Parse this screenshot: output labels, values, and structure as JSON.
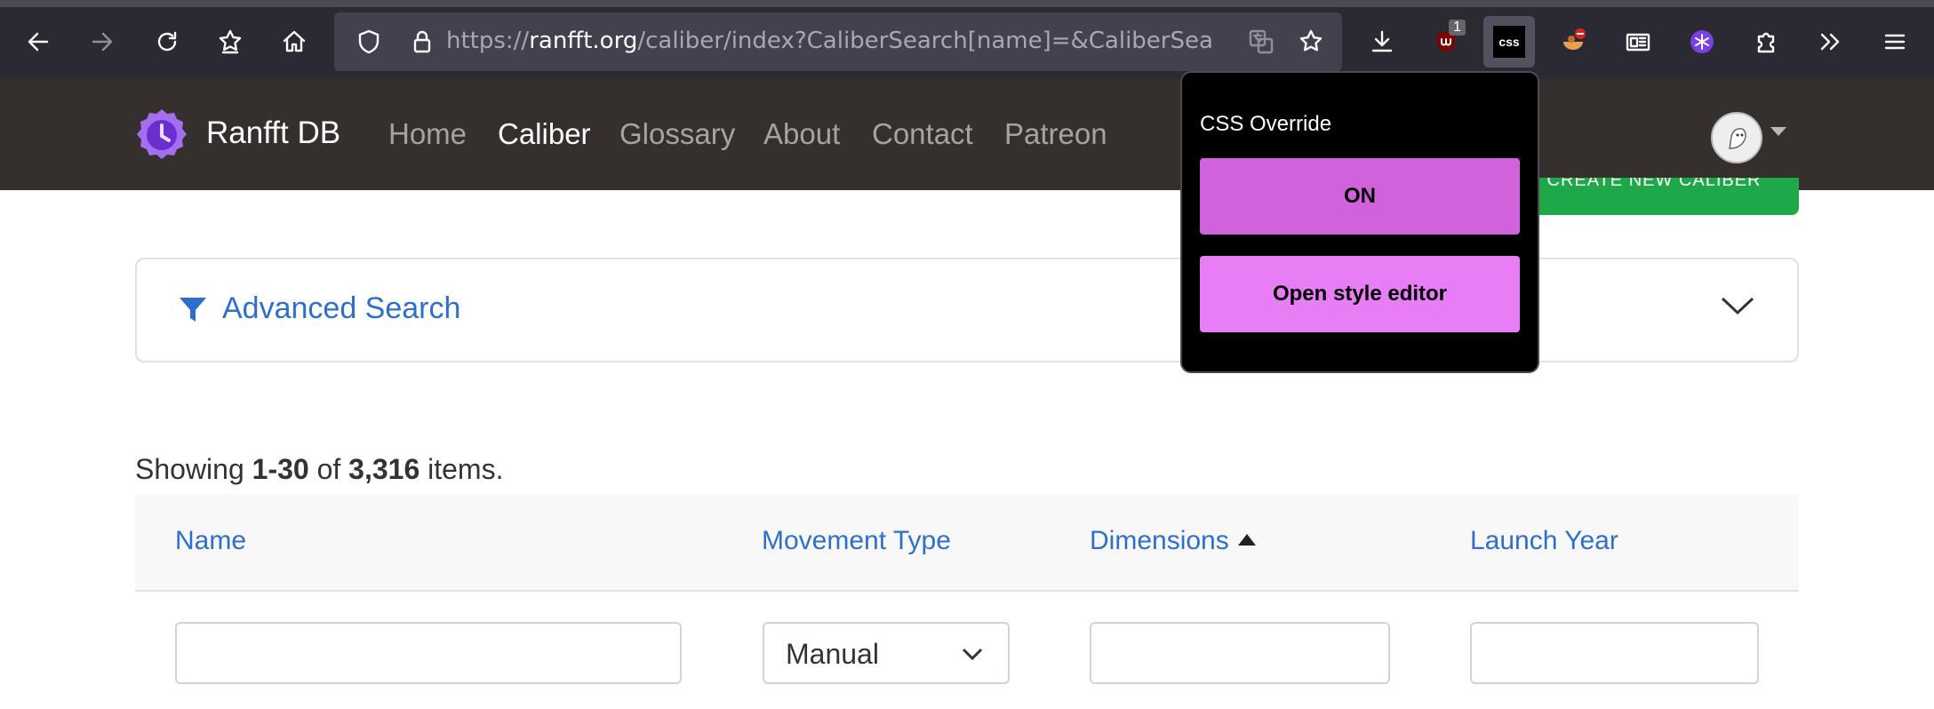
{
  "browser": {
    "url_prefix": "https://",
    "url_host": "ranfft.org",
    "url_rest": "/caliber/index?CaliberSearch[name]=&CaliberSearch[manu",
    "icons": [
      "back-icon",
      "forward-icon",
      "reload-icon",
      "extensions-star-icon",
      "home-icon",
      "shield-icon",
      "lock-icon",
      "translate-icon",
      "bookmark-star-icon",
      "download-icon",
      "ublock-icon",
      "css-icon",
      "ext-bowl-icon",
      "reader-icon",
      "snowflake-icon",
      "puzzle-icon",
      "overflow-icon",
      "menu-icon"
    ],
    "ublock_badge": "1",
    "css_label": "css"
  },
  "site": {
    "brand": "Ranfft DB",
    "nav": [
      "Home",
      "Caliber",
      "Glossary",
      "About",
      "Contact",
      "Patreon"
    ],
    "active_nav": "Caliber",
    "create_button": "CREATE NEW CALIBER"
  },
  "advanced_search": {
    "title": "Advanced Search"
  },
  "summary": {
    "prefix": "Showing ",
    "range": "1-30",
    "middle": " of ",
    "total": "3,316",
    "suffix": " items."
  },
  "table": {
    "columns": [
      "Name",
      "Movement Type",
      "Dimensions",
      "Launch Year"
    ],
    "sorted_column": "Dimensions",
    "movement_filter_value": "Manual"
  },
  "popup": {
    "title": "CSS Override",
    "on_label": "ON",
    "editor_label": "Open style editor"
  },
  "colors": {
    "toolbar": "#2b2a33",
    "site_nav": "#352f2e",
    "link_blue": "#2e6fcc",
    "create_green": "#1ea84a",
    "popup_on": "#d062dc",
    "popup_editor": "#e87ef5"
  }
}
